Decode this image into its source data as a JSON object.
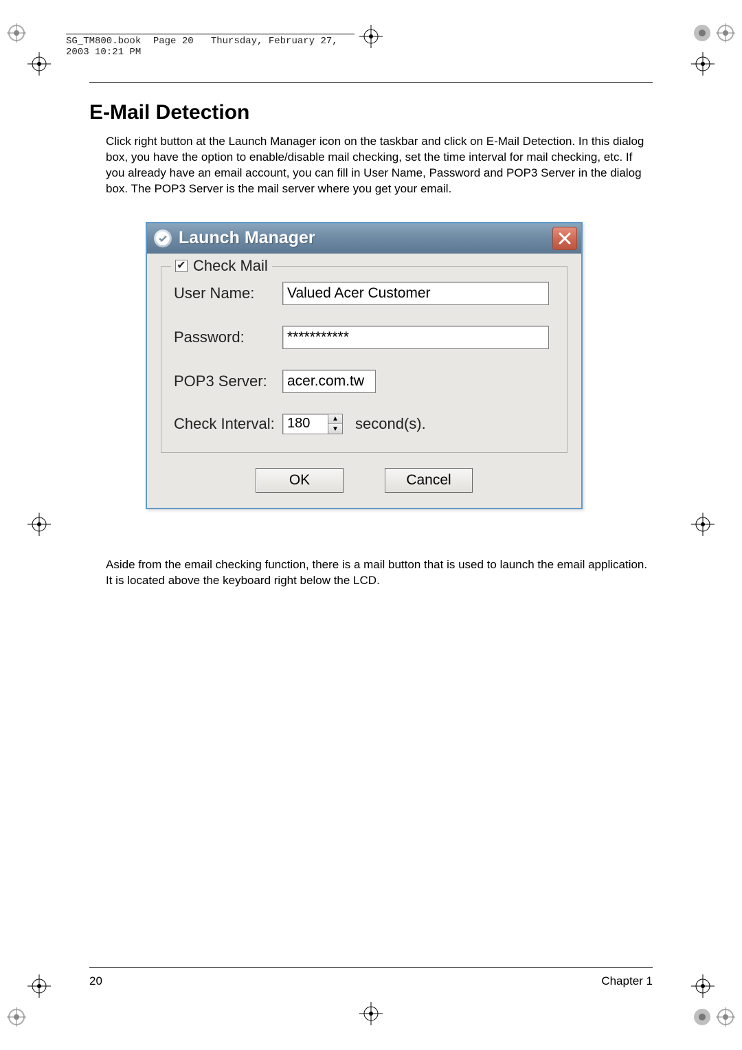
{
  "print_header": {
    "filename": "SG_TM800.book",
    "page_info": "Page 20",
    "datetime": "Thursday, February 27, 2003  10:21 PM"
  },
  "heading": "E-Mail Detection",
  "para1": "Click right button at the Launch Manager icon on the taskbar and click on E-Mail Detection. In this dialog box, you have the option to enable/disable mail checking, set the time interval for mail checking, etc. If you already have an email account, you can fill in User Name, Password and POP3 Server in the dialog box. The POP3 Server is the mail server where you get your email.",
  "dialog": {
    "title": "Launch Manager",
    "checkbox_label": "Check Mail",
    "checkbox_checked": "✔",
    "labels": {
      "user": "User Name:",
      "password": "Password:",
      "pop3": "POP3 Server:",
      "interval": "Check Interval:",
      "unit": "second(s)."
    },
    "values": {
      "user": "Valued Acer Customer",
      "password": "***********",
      "pop3": "acer.com.tw",
      "interval": "180"
    },
    "buttons": {
      "ok": "OK",
      "cancel": "Cancel"
    }
  },
  "para2": "Aside from the email checking function, there is a mail button that is used to launch the email application. It is located above the keyboard right below the LCD.",
  "footer": {
    "page_num": "20",
    "chapter": "Chapter 1"
  }
}
